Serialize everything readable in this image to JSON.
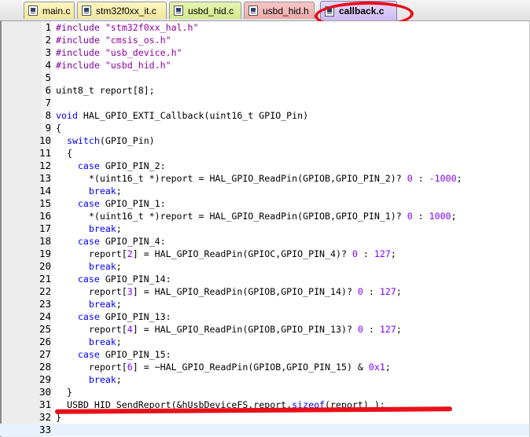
{
  "tabs": [
    {
      "id": "tab1",
      "label": "main.c",
      "active": false,
      "color": "#f0e79c"
    },
    {
      "id": "tab2",
      "label": "stm32f0xx_it.c",
      "active": false,
      "color": "#f0e79c"
    },
    {
      "id": "tab3",
      "label": "usbd_hid.c",
      "active": false,
      "color": "#d4e98e"
    },
    {
      "id": "tab4",
      "label": "usbd_hid.h",
      "active": false,
      "color": "#eeaaaa"
    },
    {
      "id": "tab5",
      "label": "callback.c",
      "active": true,
      "color": "#cdb9f3"
    }
  ],
  "annotation_color": "#e8101a",
  "editor": {
    "current_line": 33,
    "lines": [
      {
        "n": "1",
        "t": [
          [
            "pp",
            "#include "
          ],
          [
            "str",
            "\"stm32f0xx_hal.h\""
          ]
        ]
      },
      {
        "n": "2",
        "t": [
          [
            "pp",
            "#include "
          ],
          [
            "str",
            "\"cmsis_os.h\""
          ]
        ]
      },
      {
        "n": "3",
        "t": [
          [
            "pp",
            "#include "
          ],
          [
            "str",
            "\"usb_device.h\""
          ]
        ]
      },
      {
        "n": "4",
        "t": [
          [
            "pp",
            "#include "
          ],
          [
            "str",
            "\"usbd_hid.h\""
          ]
        ]
      },
      {
        "n": "5",
        "t": []
      },
      {
        "n": "6",
        "t": [
          [
            "tx",
            "uint8_t report[8];"
          ]
        ]
      },
      {
        "n": "7",
        "t": []
      },
      {
        "n": "8",
        "t": [
          [
            "kw",
            "void"
          ],
          [
            "tx",
            " HAL_GPIO_EXTI_Callback(uint16_t GPIO_Pin)"
          ]
        ]
      },
      {
        "n": "9",
        "t": [
          [
            "tx",
            "{"
          ]
        ]
      },
      {
        "n": "10",
        "t": [
          [
            "tx",
            "  "
          ],
          [
            "kw",
            "switch"
          ],
          [
            "tx",
            "(GPIO_Pin)"
          ]
        ]
      },
      {
        "n": "11",
        "t": [
          [
            "tx",
            "  {"
          ]
        ]
      },
      {
        "n": "12",
        "t": [
          [
            "tx",
            "    "
          ],
          [
            "kw",
            "case"
          ],
          [
            "tx",
            " GPIO_PIN_2:"
          ]
        ]
      },
      {
        "n": "13",
        "t": [
          [
            "tx",
            "      *(uint16_t *)report = HAL_GPIO_ReadPin(GPIOB,GPIO_PIN_2)? "
          ],
          [
            "num",
            "0"
          ],
          [
            "tx",
            " : "
          ],
          [
            "num",
            "-1000"
          ],
          [
            "tx",
            ";"
          ]
        ]
      },
      {
        "n": "14",
        "t": [
          [
            "tx",
            "      "
          ],
          [
            "kw",
            "break"
          ],
          [
            "tx",
            ";"
          ]
        ]
      },
      {
        "n": "15",
        "t": [
          [
            "tx",
            "    "
          ],
          [
            "kw",
            "case"
          ],
          [
            "tx",
            " GPIO_PIN_1:"
          ]
        ]
      },
      {
        "n": "16",
        "t": [
          [
            "tx",
            "      *(uint16_t *)report = HAL_GPIO_ReadPin(GPIOB,GPIO_PIN_1)? "
          ],
          [
            "num",
            "0"
          ],
          [
            "tx",
            " : "
          ],
          [
            "num",
            "1000"
          ],
          [
            "tx",
            ";"
          ]
        ]
      },
      {
        "n": "17",
        "t": [
          [
            "tx",
            "      "
          ],
          [
            "kw",
            "break"
          ],
          [
            "tx",
            ";"
          ]
        ]
      },
      {
        "n": "18",
        "t": [
          [
            "tx",
            "    "
          ],
          [
            "kw",
            "case"
          ],
          [
            "tx",
            " GPIO_PIN_4:"
          ]
        ]
      },
      {
        "n": "19",
        "t": [
          [
            "tx",
            "      report["
          ],
          [
            "num",
            "2"
          ],
          [
            "tx",
            "] = HAL_GPIO_ReadPin(GPIOC,GPIO_PIN_4)? "
          ],
          [
            "num",
            "0"
          ],
          [
            "tx",
            " : "
          ],
          [
            "num",
            "127"
          ],
          [
            "tx",
            ";"
          ]
        ]
      },
      {
        "n": "20",
        "t": [
          [
            "tx",
            "      "
          ],
          [
            "kw",
            "break"
          ],
          [
            "tx",
            ";"
          ]
        ]
      },
      {
        "n": "21",
        "t": [
          [
            "tx",
            "    "
          ],
          [
            "kw",
            "case"
          ],
          [
            "tx",
            " GPIO_PIN_14:"
          ]
        ]
      },
      {
        "n": "22",
        "t": [
          [
            "tx",
            "      report["
          ],
          [
            "num",
            "3"
          ],
          [
            "tx",
            "] = HAL_GPIO_ReadPin(GPIOB,GPIO_PIN_14)? "
          ],
          [
            "num",
            "0"
          ],
          [
            "tx",
            " : "
          ],
          [
            "num",
            "127"
          ],
          [
            "tx",
            ";"
          ]
        ]
      },
      {
        "n": "23",
        "t": [
          [
            "tx",
            "      "
          ],
          [
            "kw",
            "break"
          ],
          [
            "tx",
            ";"
          ]
        ]
      },
      {
        "n": "24",
        "t": [
          [
            "tx",
            "    "
          ],
          [
            "kw",
            "case"
          ],
          [
            "tx",
            " GPIO_PIN_13:"
          ]
        ]
      },
      {
        "n": "25",
        "t": [
          [
            "tx",
            "      report["
          ],
          [
            "num",
            "4"
          ],
          [
            "tx",
            "] = HAL_GPIO_ReadPin(GPIOB,GPIO_PIN_13)? "
          ],
          [
            "num",
            "0"
          ],
          [
            "tx",
            " : "
          ],
          [
            "num",
            "127"
          ],
          [
            "tx",
            ";"
          ]
        ]
      },
      {
        "n": "26",
        "t": [
          [
            "tx",
            "      "
          ],
          [
            "kw",
            "break"
          ],
          [
            "tx",
            ";"
          ]
        ]
      },
      {
        "n": "27",
        "t": [
          [
            "tx",
            "    "
          ],
          [
            "kw",
            "case"
          ],
          [
            "tx",
            " GPIO_PIN_15:"
          ]
        ]
      },
      {
        "n": "28",
        "t": [
          [
            "tx",
            "      report["
          ],
          [
            "num",
            "6"
          ],
          [
            "tx",
            "] = ~HAL_GPIO_ReadPin(GPIOB,GPIO_PIN_15) & "
          ],
          [
            "num",
            "0x1"
          ],
          [
            "tx",
            ";"
          ]
        ]
      },
      {
        "n": "29",
        "t": [
          [
            "tx",
            "      "
          ],
          [
            "kw",
            "break"
          ],
          [
            "tx",
            ";"
          ]
        ]
      },
      {
        "n": "30",
        "t": [
          [
            "tx",
            "  }"
          ]
        ]
      },
      {
        "n": "31",
        "t": [
          [
            "tx",
            "  USBD_HID_SendReport(&hUsbDeviceFS,report,"
          ],
          [
            "kw",
            "sizeof"
          ],
          [
            "tx",
            "(report) );"
          ]
        ]
      },
      {
        "n": "32",
        "t": [
          [
            "tx",
            "}"
          ]
        ]
      },
      {
        "n": "33",
        "t": []
      }
    ]
  }
}
